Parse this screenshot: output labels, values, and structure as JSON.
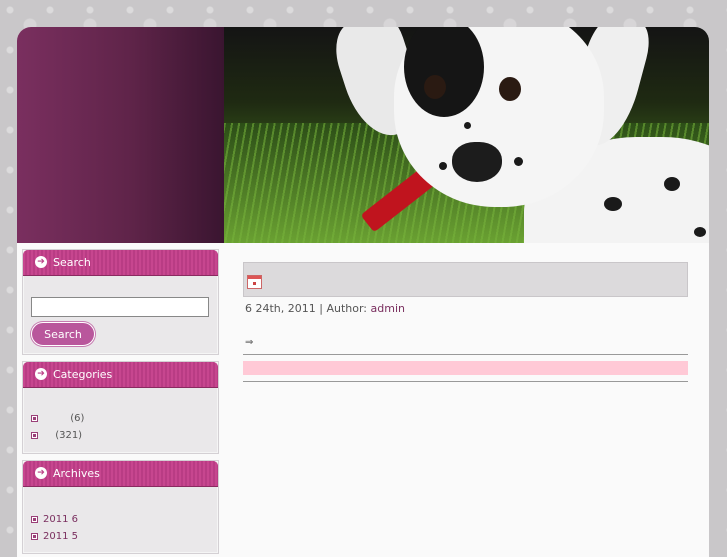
{
  "sidebar": {
    "search": {
      "title": "Search",
      "input_value": "",
      "button_label": "Search"
    },
    "categories": {
      "title": "Categories",
      "items": [
        {
          "name": "",
          "count": "(6)"
        },
        {
          "name": "",
          "count": "(321)"
        }
      ]
    },
    "archives": {
      "title": "Archives",
      "items": [
        {
          "label": "2011 6"
        },
        {
          "label": "2011 5"
        }
      ]
    }
  },
  "post": {
    "date_text": "6  24th, 2011 | Author: ",
    "author": "admin",
    "arrow": "⇒"
  },
  "colors": {
    "accent": "#c0408a",
    "header_left": "#6a2852",
    "highlight_bar": "#ffc9d6"
  }
}
